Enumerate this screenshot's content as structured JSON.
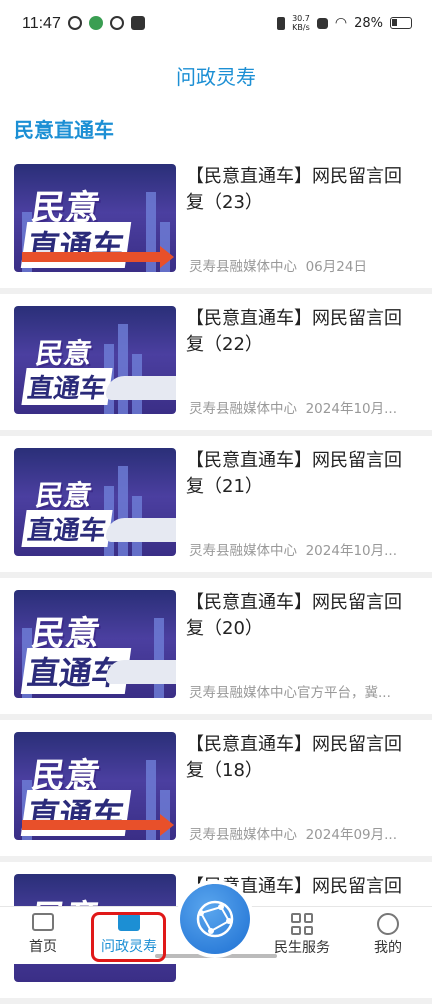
{
  "status_bar": {
    "time": "11:47",
    "speed": "30.7",
    "speed_unit": "KB/s",
    "battery": "28%"
  },
  "header": {
    "title": "问政灵寿"
  },
  "section": {
    "title": "民意直通车"
  },
  "articles": [
    {
      "title": "【民意直通车】网民留言回复（23）",
      "source": "灵寿县融媒体中心",
      "date": "06月24日"
    },
    {
      "title": "【民意直通车】网民留言回复（22）",
      "source": "灵寿县融媒体中心",
      "date": "2024年10月..."
    },
    {
      "title": "【民意直通车】网民留言回复（21）",
      "source": "灵寿县融媒体中心",
      "date": "2024年10月..."
    },
    {
      "title": "【民意直通车】网民留言回复（20）",
      "source": "灵寿县融媒体中心官方平台，冀...",
      "date": ""
    },
    {
      "title": "【民意直通车】网民留言回复（18）",
      "source": "灵寿县融媒体中心",
      "date": "2024年09月..."
    },
    {
      "title": "【民意直通车】网民留言回复（",
      "source": "",
      "date": ""
    }
  ],
  "thumb_text": {
    "line1": "民意",
    "line2": "直通车"
  },
  "bottom_nav": {
    "home": "首页",
    "wenzheng": "问政灵寿",
    "minsheng": "民生服务",
    "mine": "我的"
  },
  "colors": {
    "accent": "#1c8fd4",
    "highlight": "#e01818"
  }
}
